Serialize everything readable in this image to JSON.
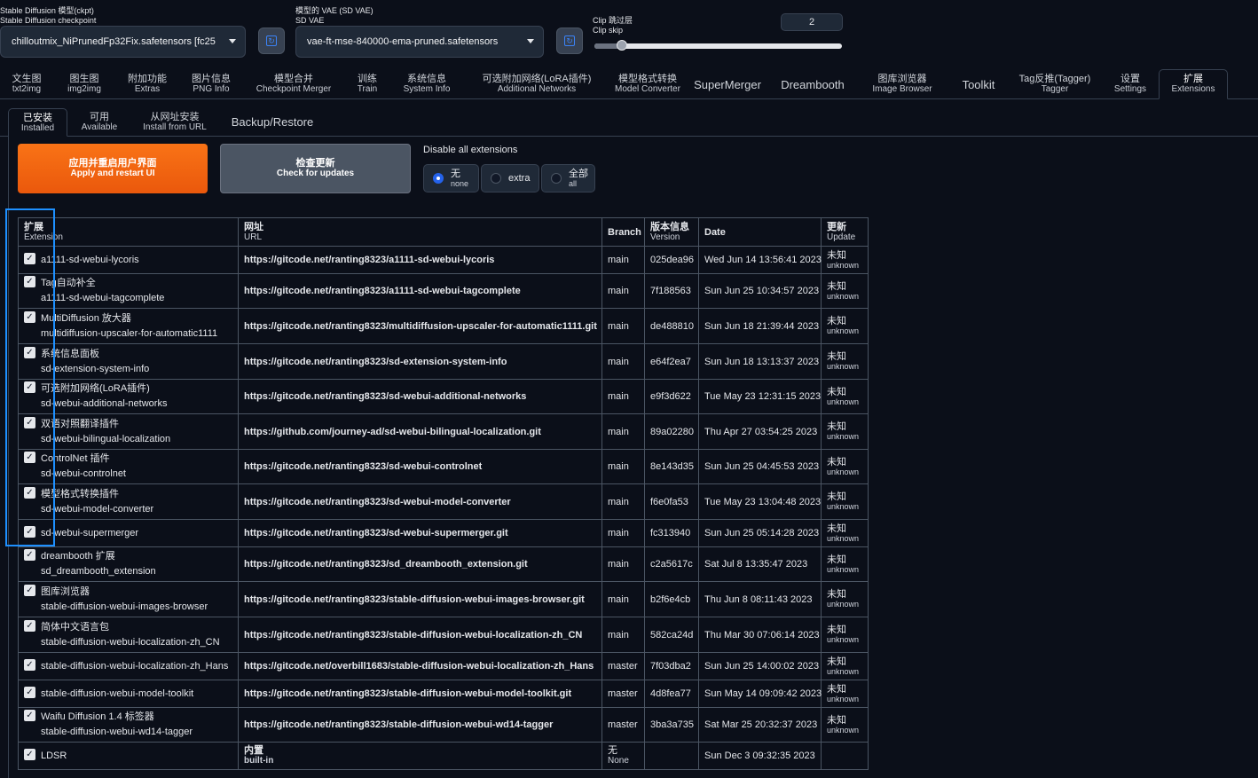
{
  "top": {
    "checkpoint": {
      "label_zh": "Stable Diffusion 模型(ckpt)",
      "label_en": "Stable Diffusion checkpoint",
      "value": "chilloutmix_NiPrunedFp32Fix.safetensors [fc25"
    },
    "vae": {
      "label_zh": "模型的 VAE (SD VAE)",
      "label_en": "SD VAE",
      "value": "vae-ft-mse-840000-ema-pruned.safetensors"
    },
    "clip_skip": {
      "label_zh": "Clip 跳过层",
      "label_en": "Clip skip",
      "value": "2",
      "slider_fraction": 0.11
    }
  },
  "main_tabs": [
    {
      "zh": "文生图",
      "en": "txt2img"
    },
    {
      "zh": "图生图",
      "en": "img2img"
    },
    {
      "zh": "附加功能",
      "en": "Extras"
    },
    {
      "zh": "图片信息",
      "en": "PNG Info"
    },
    {
      "zh": "模型合并",
      "en": "Checkpoint Merger"
    },
    {
      "zh": "训练",
      "en": "Train"
    },
    {
      "zh": "系统信息",
      "en": "System Info"
    },
    {
      "zh": "可选附加网络(LoRA插件)",
      "en": "Additional Networks"
    },
    {
      "zh": "模型格式转换",
      "en": "Model Converter"
    },
    {
      "single": "SuperMerger"
    },
    {
      "single": "Dreambooth"
    },
    {
      "zh": "图库浏览器",
      "en": "Image Browser"
    },
    {
      "single": "Toolkit"
    },
    {
      "zh": "Tag反推(Tagger)",
      "en": "Tagger"
    },
    {
      "zh": "设置",
      "en": "Settings"
    },
    {
      "zh": "扩展",
      "en": "Extensions",
      "active": true
    }
  ],
  "sub_tabs": [
    {
      "zh": "已安装",
      "en": "Installed",
      "active": true
    },
    {
      "zh": "可用",
      "en": "Available"
    },
    {
      "zh": "从网址安装",
      "en": "Install from URL"
    },
    {
      "single": "Backup/Restore"
    }
  ],
  "actions": {
    "apply": {
      "zh": "应用并重启用户界面",
      "en": "Apply and restart UI"
    },
    "check": {
      "zh": "检查更新",
      "en": "Check for updates"
    },
    "disable_label": "Disable all extensions",
    "radios": [
      {
        "zh": "无",
        "en": "none",
        "checked": true
      },
      {
        "single": "extra"
      },
      {
        "zh": "全部",
        "en": "all"
      }
    ]
  },
  "table": {
    "headers": {
      "ext_zh": "扩展",
      "ext_en": "Extension",
      "url_zh": "网址",
      "url_en": "URL",
      "branch": "Branch",
      "ver_zh": "版本信息",
      "ver_en": "Version",
      "date": "Date",
      "upd_zh": "更新",
      "upd_en": "Update"
    },
    "rows": [
      {
        "name1": "a1111-sd-webui-lycoris",
        "name2": "",
        "url": "https://gitcode.net/ranting8323/a1111-sd-webui-lycoris",
        "branch": "main",
        "version": "025dea96",
        "date": "Wed Jun 14 13:56:41 2023",
        "upd_zh": "未知",
        "upd_en": "unknown"
      },
      {
        "name1": "Tag自动补全",
        "name2": "a1111-sd-webui-tagcomplete",
        "url": "https://gitcode.net/ranting8323/a1111-sd-webui-tagcomplete",
        "branch": "main",
        "version": "7f188563",
        "date": "Sun Jun 25 10:34:57 2023",
        "upd_zh": "未知",
        "upd_en": "unknown"
      },
      {
        "name1": "MultiDiffusion 放大器",
        "name2": "multidiffusion-upscaler-for-automatic1111",
        "url": "https://gitcode.net/ranting8323/multidiffusion-upscaler-for-automatic1111.git",
        "branch": "main",
        "version": "de488810",
        "date": "Sun Jun 18 21:39:44 2023",
        "upd_zh": "未知",
        "upd_en": "unknown"
      },
      {
        "name1": "系统信息面板",
        "name2": "sd-extension-system-info",
        "url": "https://gitcode.net/ranting8323/sd-extension-system-info",
        "branch": "main",
        "version": "e64f2ea7",
        "date": "Sun Jun 18 13:13:37 2023",
        "upd_zh": "未知",
        "upd_en": "unknown"
      },
      {
        "name1": "可选附加网络(LoRA插件)",
        "name2": "sd-webui-additional-networks",
        "url": "https://gitcode.net/ranting8323/sd-webui-additional-networks",
        "branch": "main",
        "version": "e9f3d622",
        "date": "Tue May 23 12:31:15 2023",
        "upd_zh": "未知",
        "upd_en": "unknown"
      },
      {
        "name1": "双语对照翻译插件",
        "name2": "sd-webui-bilingual-localization",
        "url": "https://github.com/journey-ad/sd-webui-bilingual-localization.git",
        "branch": "main",
        "version": "89a02280",
        "date": "Thu Apr 27 03:54:25 2023",
        "upd_zh": "未知",
        "upd_en": "unknown"
      },
      {
        "name1": "ControlNet 插件",
        "name2": "sd-webui-controlnet",
        "url": "https://gitcode.net/ranting8323/sd-webui-controlnet",
        "branch": "main",
        "version": "8e143d35",
        "date": "Sun Jun 25 04:45:53 2023",
        "upd_zh": "未知",
        "upd_en": "unknown"
      },
      {
        "name1": "模型格式转换插件",
        "name2": "sd-webui-model-converter",
        "url": "https://gitcode.net/ranting8323/sd-webui-model-converter",
        "branch": "main",
        "version": "f6e0fa53",
        "date": "Tue May 23 13:04:48 2023",
        "upd_zh": "未知",
        "upd_en": "unknown"
      },
      {
        "name1": "sd-webui-supermerger",
        "name2": "",
        "url": "https://gitcode.net/ranting8323/sd-webui-supermerger.git",
        "branch": "main",
        "version": "fc313940",
        "date": "Sun Jun 25 05:14:28 2023",
        "upd_zh": "未知",
        "upd_en": "unknown"
      },
      {
        "name1": "dreambooth 扩展",
        "name2": "sd_dreambooth_extension",
        "url": "https://gitcode.net/ranting8323/sd_dreambooth_extension.git",
        "branch": "main",
        "version": "c2a5617c",
        "date": "Sat Jul 8 13:35:47 2023",
        "upd_zh": "未知",
        "upd_en": "unknown"
      },
      {
        "name1": "图库浏览器",
        "name2": "stable-diffusion-webui-images-browser",
        "url": "https://gitcode.net/ranting8323/stable-diffusion-webui-images-browser.git",
        "branch": "main",
        "version": "b2f6e4cb",
        "date": "Thu Jun 8 08:11:43 2023",
        "upd_zh": "未知",
        "upd_en": "unknown"
      },
      {
        "name1": "简体中文语言包",
        "name2": "stable-diffusion-webui-localization-zh_CN",
        "url": "https://gitcode.net/ranting8323/stable-diffusion-webui-localization-zh_CN",
        "branch": "main",
        "version": "582ca24d",
        "date": "Thu Mar 30 07:06:14 2023",
        "upd_zh": "未知",
        "upd_en": "unknown"
      },
      {
        "name1": "stable-diffusion-webui-localization-zh_Hans",
        "name2": "",
        "url": "https://gitcode.net/overbill1683/stable-diffusion-webui-localization-zh_Hans",
        "branch": "master",
        "version": "7f03dba2",
        "date": "Sun Jun 25 14:00:02 2023",
        "upd_zh": "未知",
        "upd_en": "unknown"
      },
      {
        "name1": "stable-diffusion-webui-model-toolkit",
        "name2": "",
        "url": "https://gitcode.net/ranting8323/stable-diffusion-webui-model-toolkit.git",
        "branch": "master",
        "version": "4d8fea77",
        "date": "Sun May 14 09:09:42 2023",
        "upd_zh": "未知",
        "upd_en": "unknown"
      },
      {
        "name1": "Waifu Diffusion 1.4 标签器",
        "name2": "stable-diffusion-webui-wd14-tagger",
        "url": "https://gitcode.net/ranting8323/stable-diffusion-webui-wd14-tagger",
        "branch": "master",
        "version": "3ba3a735",
        "date": "Sat Mar 25 20:32:37 2023",
        "upd_zh": "未知",
        "upd_en": "unknown"
      },
      {
        "name1": "LDSR",
        "name2": "",
        "url_zh": "内置",
        "url_en": "built-in",
        "branch_zh": "无",
        "branch_en": "None",
        "version": "",
        "date": "Sun Dec 3 09:32:35 2023",
        "upd_zh": "",
        "upd_en": ""
      }
    ]
  }
}
